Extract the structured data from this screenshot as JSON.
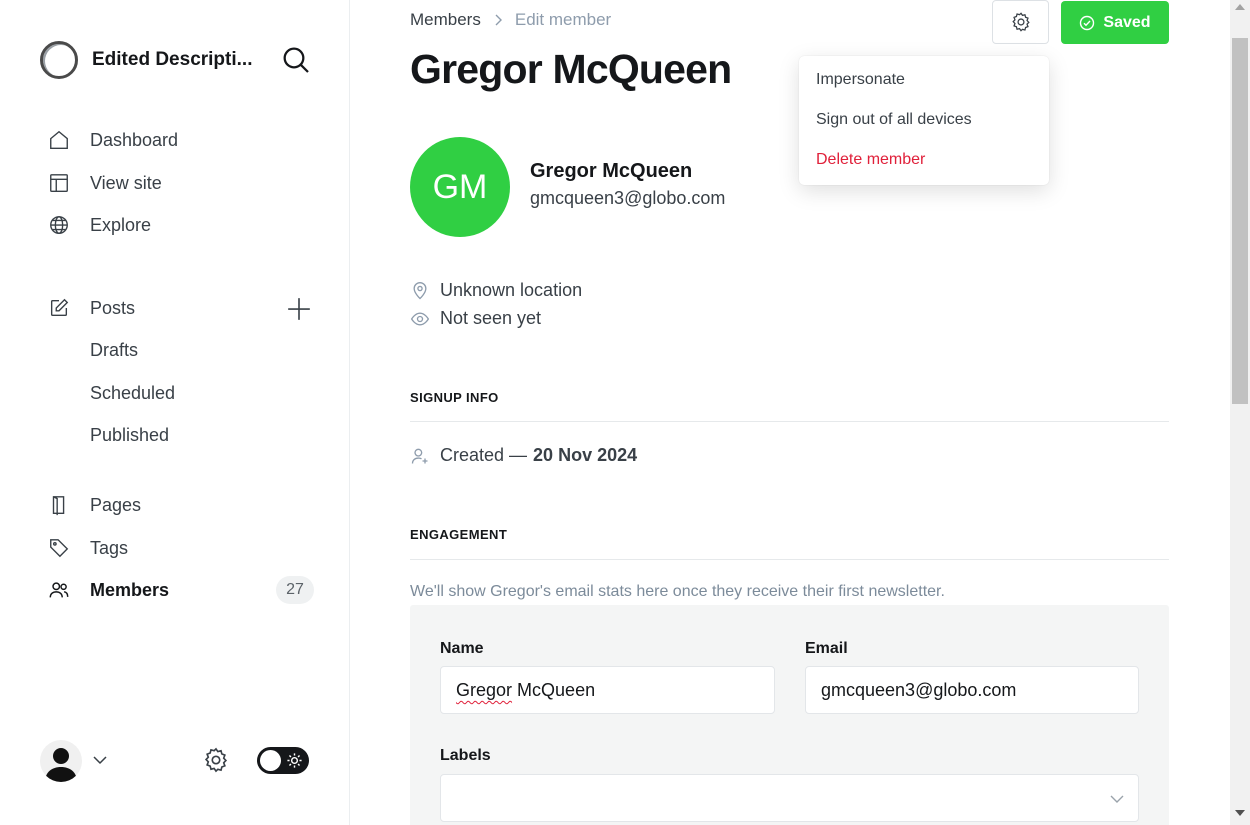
{
  "sidebar": {
    "site_name": "Edited Descripti...",
    "nav": {
      "dashboard": "Dashboard",
      "view_site": "View site",
      "explore": "Explore",
      "posts": "Posts",
      "drafts": "Drafts",
      "scheduled": "Scheduled",
      "published": "Published",
      "pages": "Pages",
      "tags": "Tags",
      "members": "Members",
      "members_count": "27"
    }
  },
  "header": {
    "breadcrumb_parent": "Members",
    "breadcrumb_current": "Edit member",
    "title": "Gregor McQueen",
    "saved_label": "Saved"
  },
  "dropdown": {
    "impersonate": "Impersonate",
    "sign_out_all": "Sign out of all devices",
    "delete_member": "Delete member"
  },
  "member": {
    "initials": "GM",
    "name": "Gregor McQueen",
    "email": "gmcqueen3@globo.com",
    "location": "Unknown location",
    "last_seen": "Not seen yet"
  },
  "signup_info": {
    "heading": "SIGNUP INFO",
    "created_label": "Created —",
    "created_date": "20 Nov 2024"
  },
  "engagement": {
    "heading": "ENGAGEMENT",
    "note": "We'll show Gregor's email stats here once they receive their first newsletter."
  },
  "form": {
    "name_label": "Name",
    "name_first": "Gregor",
    "name_last": "McQueen",
    "email_label": "Email",
    "email_value": "gmcqueen3@globo.com",
    "labels_label": "Labels"
  },
  "colors": {
    "accent_green": "#30cf43",
    "danger_red": "#e0203a"
  }
}
